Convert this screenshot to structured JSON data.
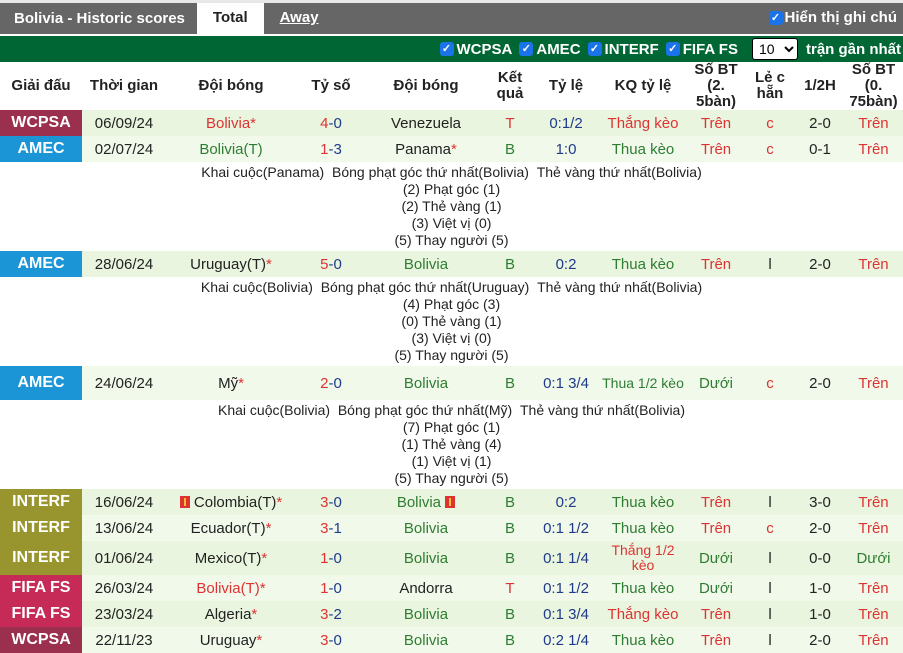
{
  "header": {
    "title": "Bolivia - Historic scores",
    "tabs": [
      {
        "label": "Total",
        "active": true
      },
      {
        "label": "Away",
        "active": false
      }
    ],
    "show_notes": {
      "label": "Hiển thị ghi chú",
      "checked": true
    }
  },
  "filters": {
    "items": [
      {
        "label": "WCPSA",
        "checked": true
      },
      {
        "label": "AMEC",
        "checked": true
      },
      {
        "label": "INTERF",
        "checked": true
      },
      {
        "label": "FIFA FS",
        "checked": true
      }
    ],
    "count_select": "10",
    "count_label": "trận gần nhất"
  },
  "columns": [
    "Giải đấu",
    "Thời gian",
    "Đội bóng",
    "Tỷ số",
    "Đội bóng",
    "Kết quả",
    "Tỷ lệ",
    "KQ tỷ lệ",
    "Số BT (2.5bàn)",
    "Lẻ chẵn",
    "1/2H",
    "Số BT (0.75bàn)"
  ],
  "column_display": {
    "result": [
      "Kết",
      "quả"
    ],
    "bt25": [
      "Số BT (2.",
      "5bàn)"
    ],
    "oddeven": [
      "Lẻ c",
      "hẵn"
    ],
    "bt075": [
      "Số BT (0.",
      "75bàn)"
    ]
  },
  "league_colors": {
    "WCPSA": "#9a2f4e",
    "AMEC": "#1b95d6",
    "INTERF": "#99952e",
    "FIFA FS": "#c62a57"
  },
  "matches": [
    {
      "league": "WCPSA",
      "date": "06/09/24",
      "home": "Bolivia",
      "home_suffix": "*",
      "home_color": "red",
      "score_h": "4",
      "score_a": "0",
      "away": "Venezuela",
      "away_suffix": "",
      "away_color": "dark",
      "result": "T",
      "handicap": "0:1/2",
      "handicap_result": "Thắng kèo",
      "hr_color": "red",
      "bt25": "Trên",
      "bt25_color": "red",
      "oddeven": "c",
      "half": "2-0",
      "bt075": "Trên"
    },
    {
      "league": "AMEC",
      "date": "02/07/24",
      "home": "Bolivia(T)",
      "home_suffix": "",
      "home_color": "green",
      "score_h": "1",
      "score_a": "3",
      "away": "Panama",
      "away_suffix": "*",
      "away_color": "dark",
      "result": "B",
      "handicap": "1:0",
      "handicap_result": "Thua kèo",
      "hr_color": "green",
      "bt25": "Trên",
      "bt25_color": "red",
      "oddeven": "c",
      "half": "0-1",
      "bt075": "Trên",
      "details": {
        "first_row": [
          "Khai cuộc(Panama)",
          "Bóng phạt góc thứ nhất(Bolivia)",
          "Thẻ vàng thứ nhất(Bolivia)"
        ],
        "stats": [
          "(2) Phạt góc (1)",
          "(2) Thẻ vàng (1)",
          "(3) Việt vị (0)",
          "(5) Thay người (5)"
        ]
      }
    },
    {
      "league": "AMEC",
      "date": "28/06/24",
      "home": "Uruguay(T)",
      "home_suffix": "*",
      "home_color": "dark",
      "score_h": "5",
      "score_a": "0",
      "away": "Bolivia",
      "away_suffix": "",
      "away_color": "green",
      "result": "B",
      "handicap": "0:2",
      "handicap_result": "Thua kèo",
      "hr_color": "green",
      "bt25": "Trên",
      "bt25_color": "red",
      "oddeven": "l",
      "half": "2-0",
      "bt075": "Trên",
      "details": {
        "first_row": [
          "Khai cuộc(Bolivia)",
          "Bóng phạt góc thứ nhất(Uruguay)",
          "Thẻ vàng thứ nhất(Bolivia)"
        ],
        "stats": [
          "(4) Phạt góc (3)",
          "(0) Thẻ vàng (1)",
          "(3) Việt vị (0)",
          "(5) Thay người (5)"
        ]
      }
    },
    {
      "league": "AMEC",
      "date": "24/06/24",
      "home": "Mỹ",
      "home_suffix": "*",
      "home_color": "dark",
      "score_h": "2",
      "score_a": "0",
      "away": "Bolivia",
      "away_suffix": "",
      "away_color": "green",
      "result": "B",
      "handicap": "0:1 3/4",
      "handicap_result": "Thua 1/2 kèo",
      "hr_color": "green",
      "bt25": "Dưới",
      "bt25_color": "green",
      "oddeven": "c",
      "half": "2-0",
      "bt075": "Trên",
      "tall": true,
      "details": {
        "first_row": [
          "Khai cuộc(Bolivia)",
          "Bóng phạt góc thứ nhất(Mỹ)",
          "Thẻ vàng thứ nhất(Bolivia)"
        ],
        "stats": [
          "(7) Phạt góc (1)",
          "(1) Thẻ vàng (4)",
          "(1) Việt vị (1)",
          "(5) Thay người (5)"
        ]
      }
    },
    {
      "league": "INTERF",
      "date": "16/06/24",
      "home": "Colombia(T)",
      "home_suffix": "*",
      "home_color": "dark",
      "home_redcard": true,
      "score_h": "3",
      "score_a": "0",
      "away": "Bolivia",
      "away_suffix": "",
      "away_color": "green",
      "away_redcard": true,
      "result": "B",
      "handicap": "0:2",
      "handicap_result": "Thua kèo",
      "hr_color": "green",
      "bt25": "Trên",
      "bt25_color": "red",
      "oddeven": "l",
      "half": "3-0",
      "bt075": "Trên"
    },
    {
      "league": "INTERF",
      "date": "13/06/24",
      "home": "Ecuador(T)",
      "home_suffix": "*",
      "home_color": "dark",
      "score_h": "3",
      "score_a": "1",
      "away": "Bolivia",
      "away_suffix": "",
      "away_color": "green",
      "result": "B",
      "handicap": "0:1 1/2",
      "handicap_result": "Thua kèo",
      "hr_color": "green",
      "bt25": "Trên",
      "bt25_color": "red",
      "oddeven": "c",
      "half": "2-0",
      "bt075": "Trên"
    },
    {
      "league": "INTERF",
      "date": "01/06/24",
      "home": "Mexico(T)",
      "home_suffix": "*",
      "home_color": "dark",
      "score_h": "1",
      "score_a": "0",
      "away": "Bolivia",
      "away_suffix": "",
      "away_color": "green",
      "result": "B",
      "handicap": "0:1 1/4",
      "handicap_result": "Thắng 1/2 kèo",
      "hr_color": "red",
      "bt25": "Dưới",
      "bt25_color": "green",
      "oddeven": "l",
      "half": "0-0",
      "bt075": "Dưới",
      "tall": true
    },
    {
      "league": "FIFA FS",
      "date": "26/03/24",
      "home": "Bolivia(T)",
      "home_suffix": "*",
      "home_color": "red",
      "score_h": "1",
      "score_a": "0",
      "away": "Andorra",
      "away_suffix": "",
      "away_color": "dark",
      "result": "T",
      "handicap": "0:1 1/2",
      "handicap_result": "Thua kèo",
      "hr_color": "green",
      "bt25": "Dưới",
      "bt25_color": "green",
      "oddeven": "l",
      "half": "1-0",
      "bt075": "Trên"
    },
    {
      "league": "FIFA FS",
      "date": "23/03/24",
      "home": "Algeria",
      "home_suffix": "*",
      "home_color": "dark",
      "score_h": "3",
      "score_a": "2",
      "away": "Bolivia",
      "away_suffix": "",
      "away_color": "green",
      "result": "B",
      "handicap": "0:1 3/4",
      "handicap_result": "Thắng kèo",
      "hr_color": "red",
      "bt25": "Trên",
      "bt25_color": "red",
      "oddeven": "l",
      "half": "1-0",
      "bt075": "Trên"
    },
    {
      "league": "WCPSA",
      "date": "22/11/23",
      "home": "Uruguay",
      "home_suffix": "*",
      "home_color": "dark",
      "score_h": "3",
      "score_a": "0",
      "away": "Bolivia",
      "away_suffix": "",
      "away_color": "green",
      "result": "B",
      "handicap": "0:2 1/4",
      "handicap_result": "Thua kèo",
      "hr_color": "green",
      "bt25": "Trên",
      "bt25_color": "red",
      "oddeven": "l",
      "half": "2-0",
      "bt075": "Trên"
    }
  ]
}
